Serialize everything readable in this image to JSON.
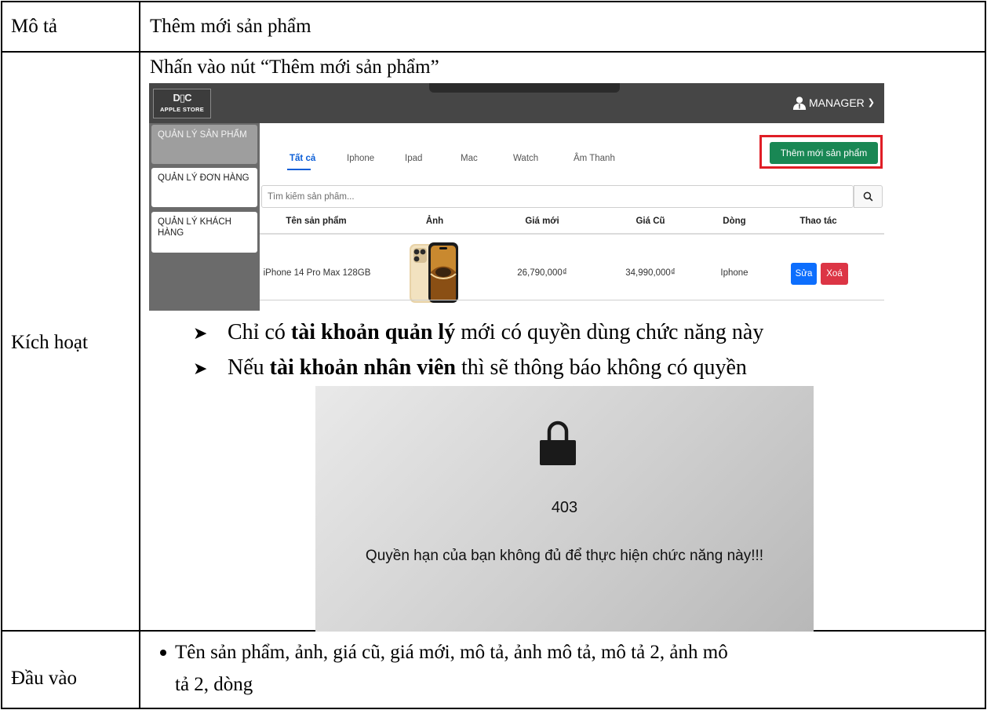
{
  "rows": [
    {
      "label": "Mô tả",
      "value": "Thêm mới sản phẩm"
    },
    {
      "label": "Kích hoạt",
      "intro": "Nhấn vào nút “Thêm mới sản phẩm”"
    },
    {
      "label": "Đầu vào"
    }
  ],
  "admin_screenshot": {
    "logo_text": "APPLE STORE",
    "user_menu": "MANAGER",
    "sidebar": [
      {
        "label": "QUẢN LÝ SẢN PHẨM"
      },
      {
        "label": "QUẢN LÝ ĐƠN HÀNG"
      },
      {
        "label": "QUẢN LÝ KHÁCH HÀNG"
      }
    ],
    "tabs": [
      "Tất cả",
      "Iphone",
      "Ipad",
      "Mac",
      "Watch",
      "Âm Thanh"
    ],
    "add_button": "Thêm mới sản phẩm",
    "search_placeholder": "Tìm kiếm sản phẩm...",
    "columns": [
      "Tên sản phẩm",
      "Ảnh",
      "Giá mới",
      "Giá Cũ",
      "Dòng",
      "Thao tác"
    ],
    "row": {
      "name": "iPhone 14 Pro Max 128GB",
      "new_price": "26,790,000₫",
      "old_price": "34,990,000₫",
      "line": "Iphone",
      "edit": "Sửa",
      "delete": "Xoá"
    }
  },
  "bullets": [
    {
      "before": "Chỉ có ",
      "bold": "tài khoản quản lý",
      "after": " mới có quyền dùng chức năng này"
    },
    {
      "before": "Nếu ",
      "bold": "tài khoản nhân viên",
      "after": " thì sẽ thông báo không có quyền"
    }
  ],
  "error_screenshot": {
    "code": "403",
    "message": "Quyền hạn của bạn không đủ để thực hiện chức năng này!!!"
  },
  "input_bullet": {
    "line1": "Tên sản phẩm, ảnh, giá cũ, giá mới,  mô tả, ảnh mô tả, mô tả 2, ảnh mô",
    "line2": "tả 2,  dòng"
  }
}
